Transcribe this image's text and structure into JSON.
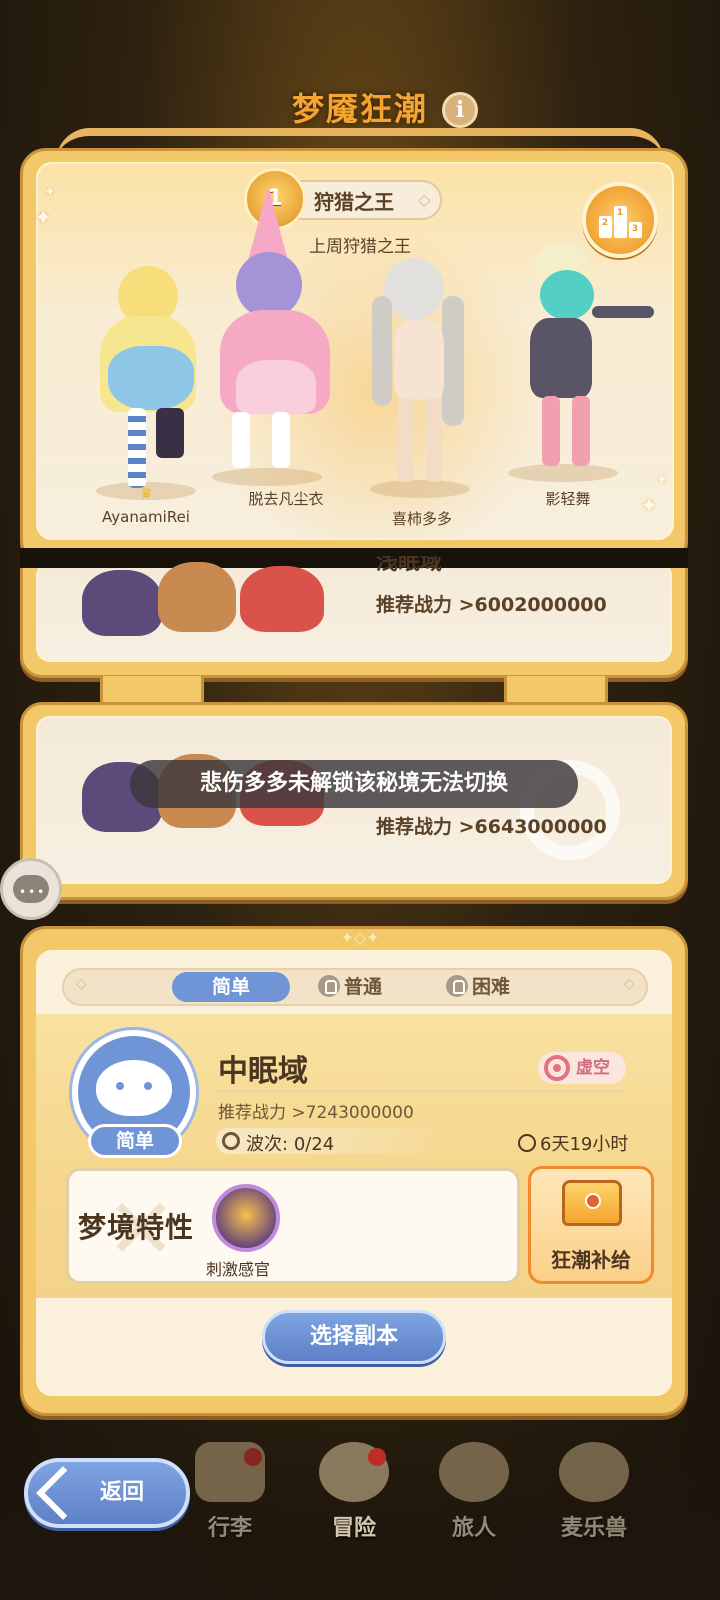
{
  "header": {
    "title": "梦魇狂潮",
    "info_icon": "i"
  },
  "king": {
    "badge": "狩猎之王",
    "rank": "1",
    "subtitle": "上周狩猎之王",
    "podium": [
      "2",
      "1",
      "3"
    ],
    "players": [
      {
        "name": "AyanamiRei"
      },
      {
        "name": "脱去凡尘衣"
      },
      {
        "name": "喜柿多多"
      },
      {
        "name": "影轻舞"
      }
    ]
  },
  "dungeons": [
    {
      "name_partial": "浅眠域",
      "power": "推荐战力  >6002000000"
    },
    {
      "power": "推荐战力  >6643000000"
    }
  ],
  "toast": "悲伤多多未解锁该秘境无法切换",
  "detail": {
    "tabs": [
      "简单",
      "普通",
      "困难"
    ],
    "dungeon_name": "中眠域",
    "difficulty": "简单",
    "element_tag": "虚空",
    "recommended_power": "推荐战力  >7243000000",
    "waves_label": "波次:",
    "waves_value": "0/24",
    "timer": "6天19小时",
    "trait_title": "梦境特性",
    "trait_name": "刺激感官",
    "supply_label": "狂潮补给",
    "select_button": "选择副本"
  },
  "nav": {
    "back": "返回",
    "items": [
      "行李",
      "冒险",
      "旅人",
      "麦乐兽"
    ]
  },
  "colors": {
    "accent_gold": "#f2c868",
    "button_blue": "#6f95d6",
    "title_orange": "#f4a531",
    "void_pink": "#e07281"
  }
}
